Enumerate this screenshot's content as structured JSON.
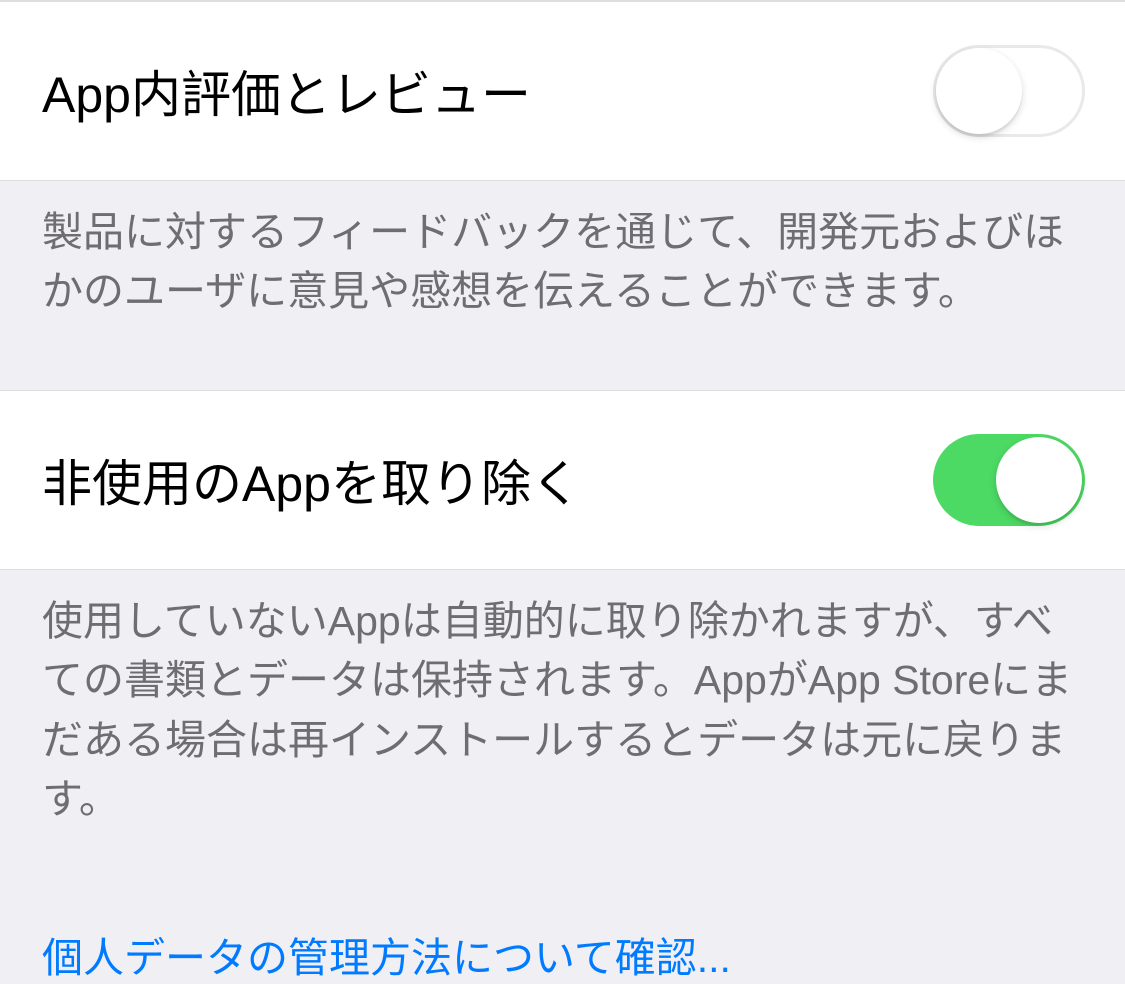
{
  "settings": {
    "in_app_ratings": {
      "label": "App内評価とレビュー",
      "enabled": false,
      "description": "製品に対するフィードバックを通じて、開発元およびほかのユーザに意見や感想を伝えることができます。"
    },
    "offload_unused_apps": {
      "label": "非使用のAppを取り除く",
      "enabled": true,
      "description": "使用していないAppは自動的に取り除かれますが、すべての書類とデータは保持されます。AppがApp Storeにまだある場合は再インストールするとデータは元に戻ります。"
    }
  },
  "footer": {
    "privacy_link": "個人データの管理方法について確認..."
  },
  "colors": {
    "toggle_on": "#4cd964",
    "link": "#007aff",
    "background": "#efeff4",
    "text_primary": "#000000",
    "text_secondary": "#6d6d72"
  }
}
